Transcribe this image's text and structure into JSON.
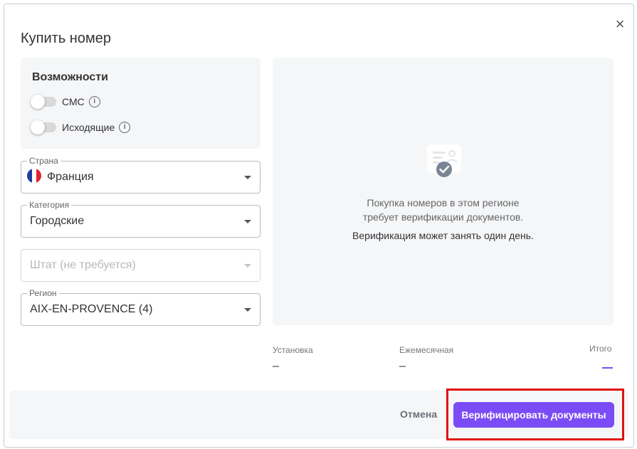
{
  "dialog": {
    "title": "Купить номер",
    "close_icon": "close-icon"
  },
  "capabilities": {
    "title": "Возможности",
    "items": [
      {
        "label": "СМС",
        "enabled": false,
        "icon": "info-icon"
      },
      {
        "label": "Исходящие",
        "enabled": false,
        "icon": "info-icon"
      }
    ]
  },
  "fields": {
    "country": {
      "label": "Страна",
      "value": "Франция",
      "flag": "france-flag-icon"
    },
    "category": {
      "label": "Категория",
      "value": "Городские"
    },
    "state": {
      "placeholder": "Штат (не требуется)"
    },
    "region": {
      "label": "Регион",
      "value": "AIX-EN-PROVENCE (4)"
    }
  },
  "verification": {
    "icon": "verified-document-icon",
    "line1": "Покупка номеров в этом регионе",
    "line2": "требует верификации документов.",
    "line3": "Верификация может занять один день."
  },
  "pricing": {
    "setup_label": "Установка",
    "setup_value": "–",
    "monthly_label": "Ежемесячная",
    "monthly_value": "–",
    "total_label": "Итого"
  },
  "footer": {
    "cancel_label": "Отмена",
    "verify_label": "Верифицировать документы"
  },
  "colors": {
    "accent": "#7b4cf5",
    "highlight_outline": "#e01010"
  }
}
